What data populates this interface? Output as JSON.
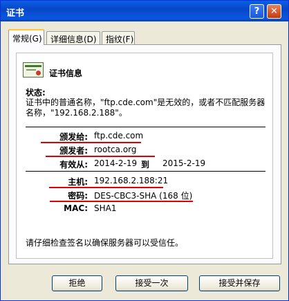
{
  "window": {
    "title": "证书",
    "help_glyph": "?",
    "close_glyph": "✕"
  },
  "tabs": [
    "常规(G)",
    "详细信息(D)",
    "指纹(F)"
  ],
  "panel": {
    "heading": "证书信息",
    "status_label": "状态:",
    "status_text": "证书中的普通名称，\"ftp.cde.com\"是无效的，或者不匹配服务器名称，\"192.168.2.188\"。",
    "issued_to_label": "颁发给:",
    "issued_to": "ftp.cde.com",
    "issuer_label": "颁发者:",
    "issuer": "rootca.org",
    "valid_label": "有效从:",
    "valid_from": "2014-2-19",
    "valid_to_label": "到",
    "valid_to": "2015-2-19",
    "host_label": "主机:",
    "host": "192.168.2.188:21",
    "cipher_label": "密码:",
    "cipher": "DES-CBC3-SHA (168 位)",
    "mac_label": "MAC:",
    "mac": "SHA1",
    "footer": "请仔细检查签名以确保服务器可以受信任。"
  },
  "buttons": {
    "reject": "拒绝",
    "accept_once": "接受一次",
    "accept_save": "接受并保存"
  },
  "annotation_color": "#e00000"
}
